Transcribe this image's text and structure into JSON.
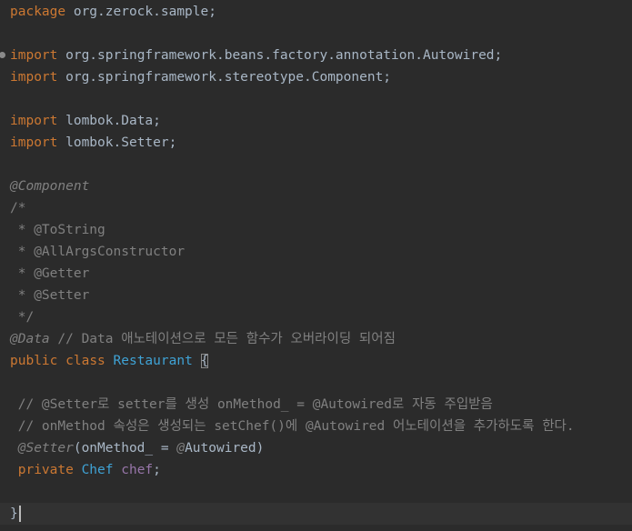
{
  "editor": {
    "lines": [
      {
        "tokens": [
          {
            "t": "package",
            "c": "kw"
          },
          {
            "t": " org.zerock.sample;",
            "c": "txt"
          }
        ]
      },
      {
        "tokens": []
      },
      {
        "fold": true,
        "tokens": [
          {
            "t": "import",
            "c": "kw"
          },
          {
            "t": " org.springframework.beans.factory.annotation.Autowired;",
            "c": "txt"
          }
        ]
      },
      {
        "tokens": [
          {
            "t": "import",
            "c": "kw"
          },
          {
            "t": " org.springframework.stereotype.Component;",
            "c": "txt"
          }
        ]
      },
      {
        "tokens": []
      },
      {
        "tokens": [
          {
            "t": "import",
            "c": "kw"
          },
          {
            "t": " lombok.Data;",
            "c": "txt"
          }
        ]
      },
      {
        "tokens": [
          {
            "t": "import",
            "c": "kw"
          },
          {
            "t": " lombok.Setter;",
            "c": "txt"
          }
        ]
      },
      {
        "tokens": []
      },
      {
        "tokens": [
          {
            "t": "@Component",
            "c": "cmt-it"
          }
        ]
      },
      {
        "tokens": [
          {
            "t": "/*",
            "c": "cmt"
          }
        ]
      },
      {
        "tokens": [
          {
            "t": " * @ToString",
            "c": "cmt"
          }
        ]
      },
      {
        "tokens": [
          {
            "t": " * @AllArgsConstructor",
            "c": "cmt"
          }
        ]
      },
      {
        "tokens": [
          {
            "t": " * @Getter",
            "c": "cmt"
          }
        ]
      },
      {
        "tokens": [
          {
            "t": " * @Setter",
            "c": "cmt"
          }
        ]
      },
      {
        "tokens": [
          {
            "t": " */",
            "c": "cmt"
          }
        ]
      },
      {
        "tokens": [
          {
            "t": "@Data",
            "c": "cmt-it"
          },
          {
            "t": " // Data 애노테이션으로 모든 함수가 오버라이딩 되어짐",
            "c": "cmt"
          }
        ]
      },
      {
        "tokens": [
          {
            "t": "public",
            "c": "kw"
          },
          {
            "t": " ",
            "c": "txt"
          },
          {
            "t": "class",
            "c": "kw"
          },
          {
            "t": " ",
            "c": "txt"
          },
          {
            "t": "Restaurant",
            "c": "cls"
          },
          {
            "t": " ",
            "c": "txt"
          },
          {
            "t": "{",
            "c": "brace"
          }
        ]
      },
      {
        "tokens": []
      },
      {
        "tokens": [
          {
            "t": " // @Setter로 setter를 생성 onMethod_ = @Autowired로 자동 주입받음",
            "c": "cmt"
          }
        ]
      },
      {
        "tokens": [
          {
            "t": " // onMethod 속성은 생성되는 setChef()에 @Autowired 어노테이션을 추가하도록 한다.",
            "c": "cmt"
          }
        ]
      },
      {
        "tokens": [
          {
            "t": " ",
            "c": "txt"
          },
          {
            "t": "@Setter",
            "c": "cmt-it"
          },
          {
            "t": "(onMethod_ = ",
            "c": "txt"
          },
          {
            "t": "@",
            "c": "cmt-it"
          },
          {
            "t": "Autowired)",
            "c": "txt"
          }
        ]
      },
      {
        "tokens": [
          {
            "t": " ",
            "c": "txt"
          },
          {
            "t": "private",
            "c": "kw"
          },
          {
            "t": " ",
            "c": "txt"
          },
          {
            "t": "Chef",
            "c": "cls"
          },
          {
            "t": " ",
            "c": "txt"
          },
          {
            "t": "chef",
            "c": "fld"
          },
          {
            "t": ";",
            "c": "txt"
          }
        ]
      },
      {
        "tokens": []
      },
      {
        "current": true,
        "tokens": [
          {
            "t": "}",
            "c": "brace-caret"
          }
        ]
      }
    ]
  },
  "colors": {
    "background": "#2b2b2b",
    "current_line": "#323232",
    "text": "#a9b7c6",
    "keyword": "#cc7832",
    "comment": "#808080",
    "class_name": "#3fa3d6",
    "field": "#9876aa"
  }
}
